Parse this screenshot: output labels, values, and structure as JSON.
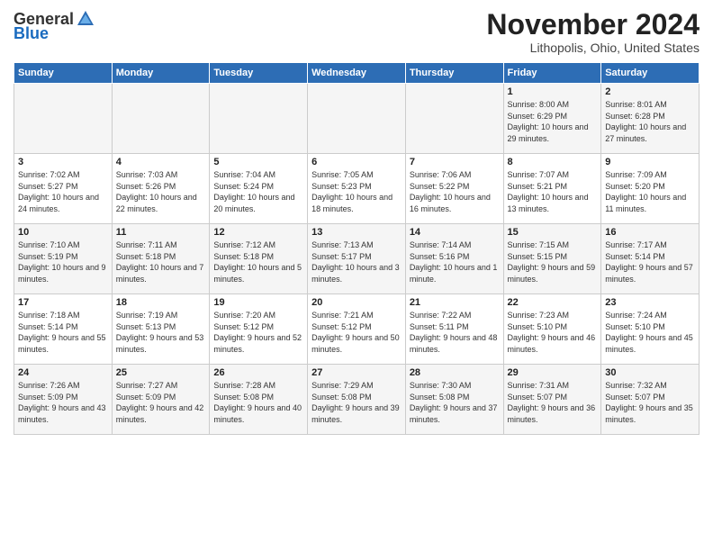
{
  "header": {
    "logo_general": "General",
    "logo_blue": "Blue",
    "month_title": "November 2024",
    "location": "Lithopolis, Ohio, United States"
  },
  "days_of_week": [
    "Sunday",
    "Monday",
    "Tuesday",
    "Wednesday",
    "Thursday",
    "Friday",
    "Saturday"
  ],
  "weeks": [
    [
      {
        "day": "",
        "info": ""
      },
      {
        "day": "",
        "info": ""
      },
      {
        "day": "",
        "info": ""
      },
      {
        "day": "",
        "info": ""
      },
      {
        "day": "",
        "info": ""
      },
      {
        "day": "1",
        "info": "Sunrise: 8:00 AM\nSunset: 6:29 PM\nDaylight: 10 hours and 29 minutes."
      },
      {
        "day": "2",
        "info": "Sunrise: 8:01 AM\nSunset: 6:28 PM\nDaylight: 10 hours and 27 minutes."
      }
    ],
    [
      {
        "day": "3",
        "info": "Sunrise: 7:02 AM\nSunset: 5:27 PM\nDaylight: 10 hours and 24 minutes."
      },
      {
        "day": "4",
        "info": "Sunrise: 7:03 AM\nSunset: 5:26 PM\nDaylight: 10 hours and 22 minutes."
      },
      {
        "day": "5",
        "info": "Sunrise: 7:04 AM\nSunset: 5:24 PM\nDaylight: 10 hours and 20 minutes."
      },
      {
        "day": "6",
        "info": "Sunrise: 7:05 AM\nSunset: 5:23 PM\nDaylight: 10 hours and 18 minutes."
      },
      {
        "day": "7",
        "info": "Sunrise: 7:06 AM\nSunset: 5:22 PM\nDaylight: 10 hours and 16 minutes."
      },
      {
        "day": "8",
        "info": "Sunrise: 7:07 AM\nSunset: 5:21 PM\nDaylight: 10 hours and 13 minutes."
      },
      {
        "day": "9",
        "info": "Sunrise: 7:09 AM\nSunset: 5:20 PM\nDaylight: 10 hours and 11 minutes."
      }
    ],
    [
      {
        "day": "10",
        "info": "Sunrise: 7:10 AM\nSunset: 5:19 PM\nDaylight: 10 hours and 9 minutes."
      },
      {
        "day": "11",
        "info": "Sunrise: 7:11 AM\nSunset: 5:18 PM\nDaylight: 10 hours and 7 minutes."
      },
      {
        "day": "12",
        "info": "Sunrise: 7:12 AM\nSunset: 5:18 PM\nDaylight: 10 hours and 5 minutes."
      },
      {
        "day": "13",
        "info": "Sunrise: 7:13 AM\nSunset: 5:17 PM\nDaylight: 10 hours and 3 minutes."
      },
      {
        "day": "14",
        "info": "Sunrise: 7:14 AM\nSunset: 5:16 PM\nDaylight: 10 hours and 1 minute."
      },
      {
        "day": "15",
        "info": "Sunrise: 7:15 AM\nSunset: 5:15 PM\nDaylight: 9 hours and 59 minutes."
      },
      {
        "day": "16",
        "info": "Sunrise: 7:17 AM\nSunset: 5:14 PM\nDaylight: 9 hours and 57 minutes."
      }
    ],
    [
      {
        "day": "17",
        "info": "Sunrise: 7:18 AM\nSunset: 5:14 PM\nDaylight: 9 hours and 55 minutes."
      },
      {
        "day": "18",
        "info": "Sunrise: 7:19 AM\nSunset: 5:13 PM\nDaylight: 9 hours and 53 minutes."
      },
      {
        "day": "19",
        "info": "Sunrise: 7:20 AM\nSunset: 5:12 PM\nDaylight: 9 hours and 52 minutes."
      },
      {
        "day": "20",
        "info": "Sunrise: 7:21 AM\nSunset: 5:12 PM\nDaylight: 9 hours and 50 minutes."
      },
      {
        "day": "21",
        "info": "Sunrise: 7:22 AM\nSunset: 5:11 PM\nDaylight: 9 hours and 48 minutes."
      },
      {
        "day": "22",
        "info": "Sunrise: 7:23 AM\nSunset: 5:10 PM\nDaylight: 9 hours and 46 minutes."
      },
      {
        "day": "23",
        "info": "Sunrise: 7:24 AM\nSunset: 5:10 PM\nDaylight: 9 hours and 45 minutes."
      }
    ],
    [
      {
        "day": "24",
        "info": "Sunrise: 7:26 AM\nSunset: 5:09 PM\nDaylight: 9 hours and 43 minutes."
      },
      {
        "day": "25",
        "info": "Sunrise: 7:27 AM\nSunset: 5:09 PM\nDaylight: 9 hours and 42 minutes."
      },
      {
        "day": "26",
        "info": "Sunrise: 7:28 AM\nSunset: 5:08 PM\nDaylight: 9 hours and 40 minutes."
      },
      {
        "day": "27",
        "info": "Sunrise: 7:29 AM\nSunset: 5:08 PM\nDaylight: 9 hours and 39 minutes."
      },
      {
        "day": "28",
        "info": "Sunrise: 7:30 AM\nSunset: 5:08 PM\nDaylight: 9 hours and 37 minutes."
      },
      {
        "day": "29",
        "info": "Sunrise: 7:31 AM\nSunset: 5:07 PM\nDaylight: 9 hours and 36 minutes."
      },
      {
        "day": "30",
        "info": "Sunrise: 7:32 AM\nSunset: 5:07 PM\nDaylight: 9 hours and 35 minutes."
      }
    ]
  ]
}
